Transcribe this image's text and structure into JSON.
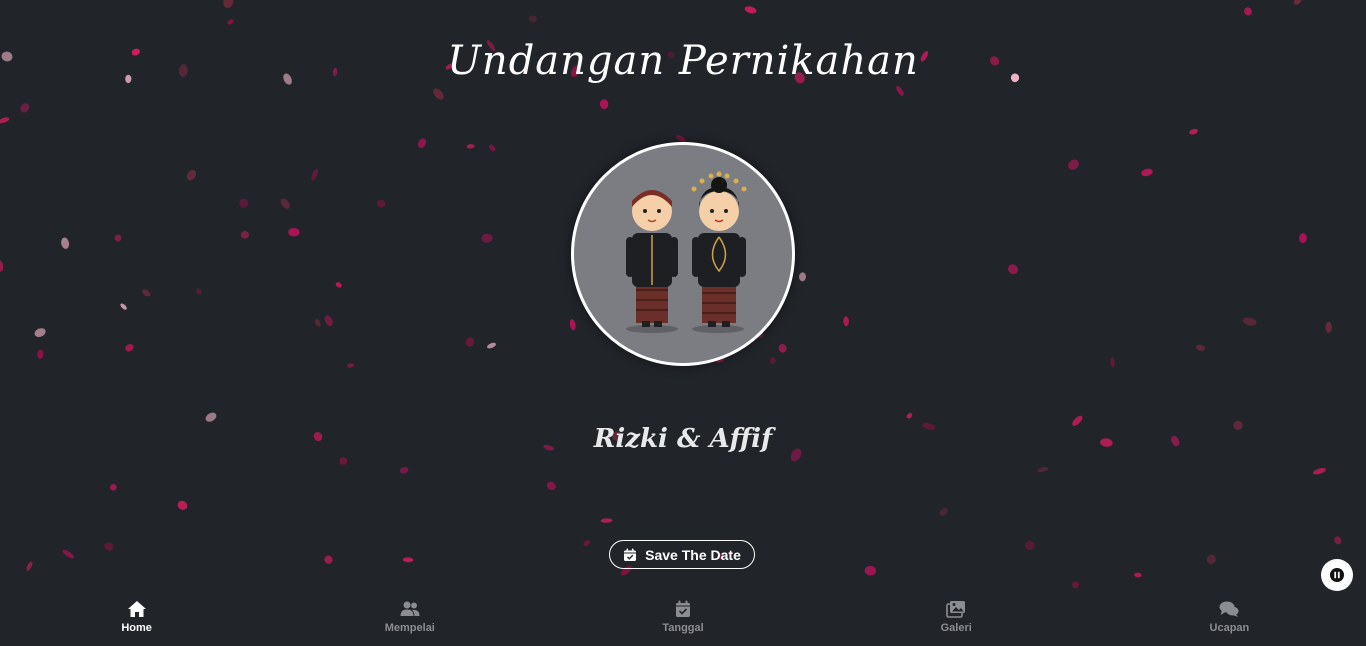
{
  "header": {
    "title": "Undangan Pernikahan"
  },
  "couple": {
    "names": "Rizki & Affif"
  },
  "actions": {
    "save_the_date_label": "Save The Date"
  },
  "nav": {
    "items": [
      {
        "label": "Home",
        "icon": "home-icon",
        "active": true
      },
      {
        "label": "Mempelai",
        "icon": "users-icon",
        "active": false
      },
      {
        "label": "Tanggal",
        "icon": "calendar-check-icon",
        "active": false
      },
      {
        "label": "Galeri",
        "icon": "images-icon",
        "active": false
      },
      {
        "label": "Ucapan",
        "icon": "comments-icon",
        "active": false
      }
    ]
  },
  "colors": {
    "background": "#212429",
    "accent": "#ffffff",
    "petal": "#c2185b",
    "inactive": "#8b8d91"
  }
}
